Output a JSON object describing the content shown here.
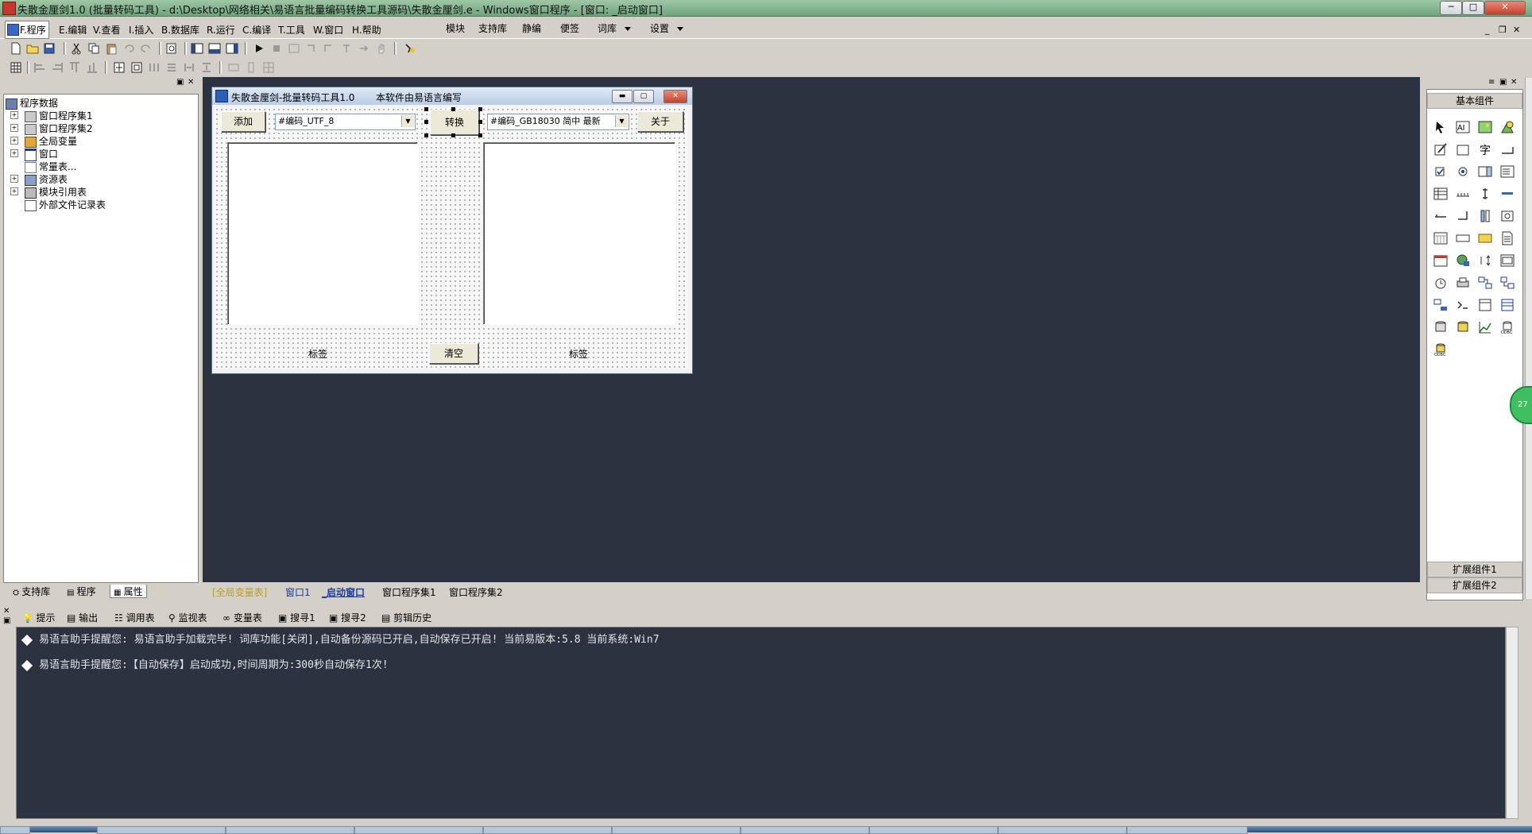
{
  "window": {
    "title": "失散金厘剑1.0 (批量转码工具)  - d:\\Desktop\\网络相关\\易语言批量编码转换工具源码\\失散金厘剑.e - Windows窗口程序 - [窗口: _启动窗口]"
  },
  "menubar": {
    "items": [
      "F.程序",
      "E.编辑",
      "V.查看",
      "I.插入",
      "B.数据库",
      "R.运行",
      "C.编译",
      "T.工具",
      "W.窗口",
      "H.帮助"
    ],
    "extra": [
      "模块",
      "支持库",
      "静编",
      "便签",
      "词库",
      "设置"
    ]
  },
  "left_panel": {
    "tree": [
      {
        "label": "程序数据",
        "icon": "program-data-icon"
      },
      {
        "label": "窗口程序集1",
        "icon": "assembly-icon"
      },
      {
        "label": "窗口程序集2",
        "icon": "assembly-icon"
      },
      {
        "label": "全局变量",
        "icon": "global-var-icon"
      },
      {
        "label": "窗口",
        "icon": "window-icon"
      },
      {
        "label": "常量表...",
        "icon": "constants-icon"
      },
      {
        "label": "资源表",
        "icon": "resources-icon"
      },
      {
        "label": "模块引用表",
        "icon": "module-ref-icon"
      },
      {
        "label": "外部文件记录表",
        "icon": "file-record-icon"
      }
    ],
    "tabs": [
      "支持库",
      "程序",
      "属性"
    ]
  },
  "designer": {
    "title": "失散金厘剑-批量转码工具1.0",
    "subtitle": "本软件由易语言编写",
    "add_button": "添加",
    "source_encoding": "#编码_UTF_8",
    "convert_button": "转换",
    "target_encoding": "#编码_GB18030 简中 最新",
    "about_button": "关于",
    "left_label": "标签",
    "clear_button": "清空",
    "right_label": "标签"
  },
  "doc_tabs": [
    "[全局变量表]",
    "窗口1",
    "_启动窗口",
    "窗口程序集1",
    "窗口程序集2"
  ],
  "right_panel": {
    "title": "基本组件",
    "ext1": "扩展组件1",
    "ext2": "扩展组件2"
  },
  "output": {
    "tabs": [
      "提示",
      "输出",
      "调用表",
      "监视表",
      "变量表",
      "搜寻1",
      "搜寻2",
      "剪辑历史"
    ],
    "lines": [
      "易语言助手提醒您:  易语言助手加载完毕!  词库功能[关闭],自动备份源码已开启,自动保存已开启!  当前易版本:5.8  当前系统:Win7",
      "易语言助手提醒您:【自动保存】启动成功,时间周期为:300秒自动保存1次!"
    ]
  },
  "float_badge": "27",
  "colors": {
    "workspace": "#2b3240",
    "title_bar": "#7fb08a",
    "chrome": "#d4d0c8"
  }
}
